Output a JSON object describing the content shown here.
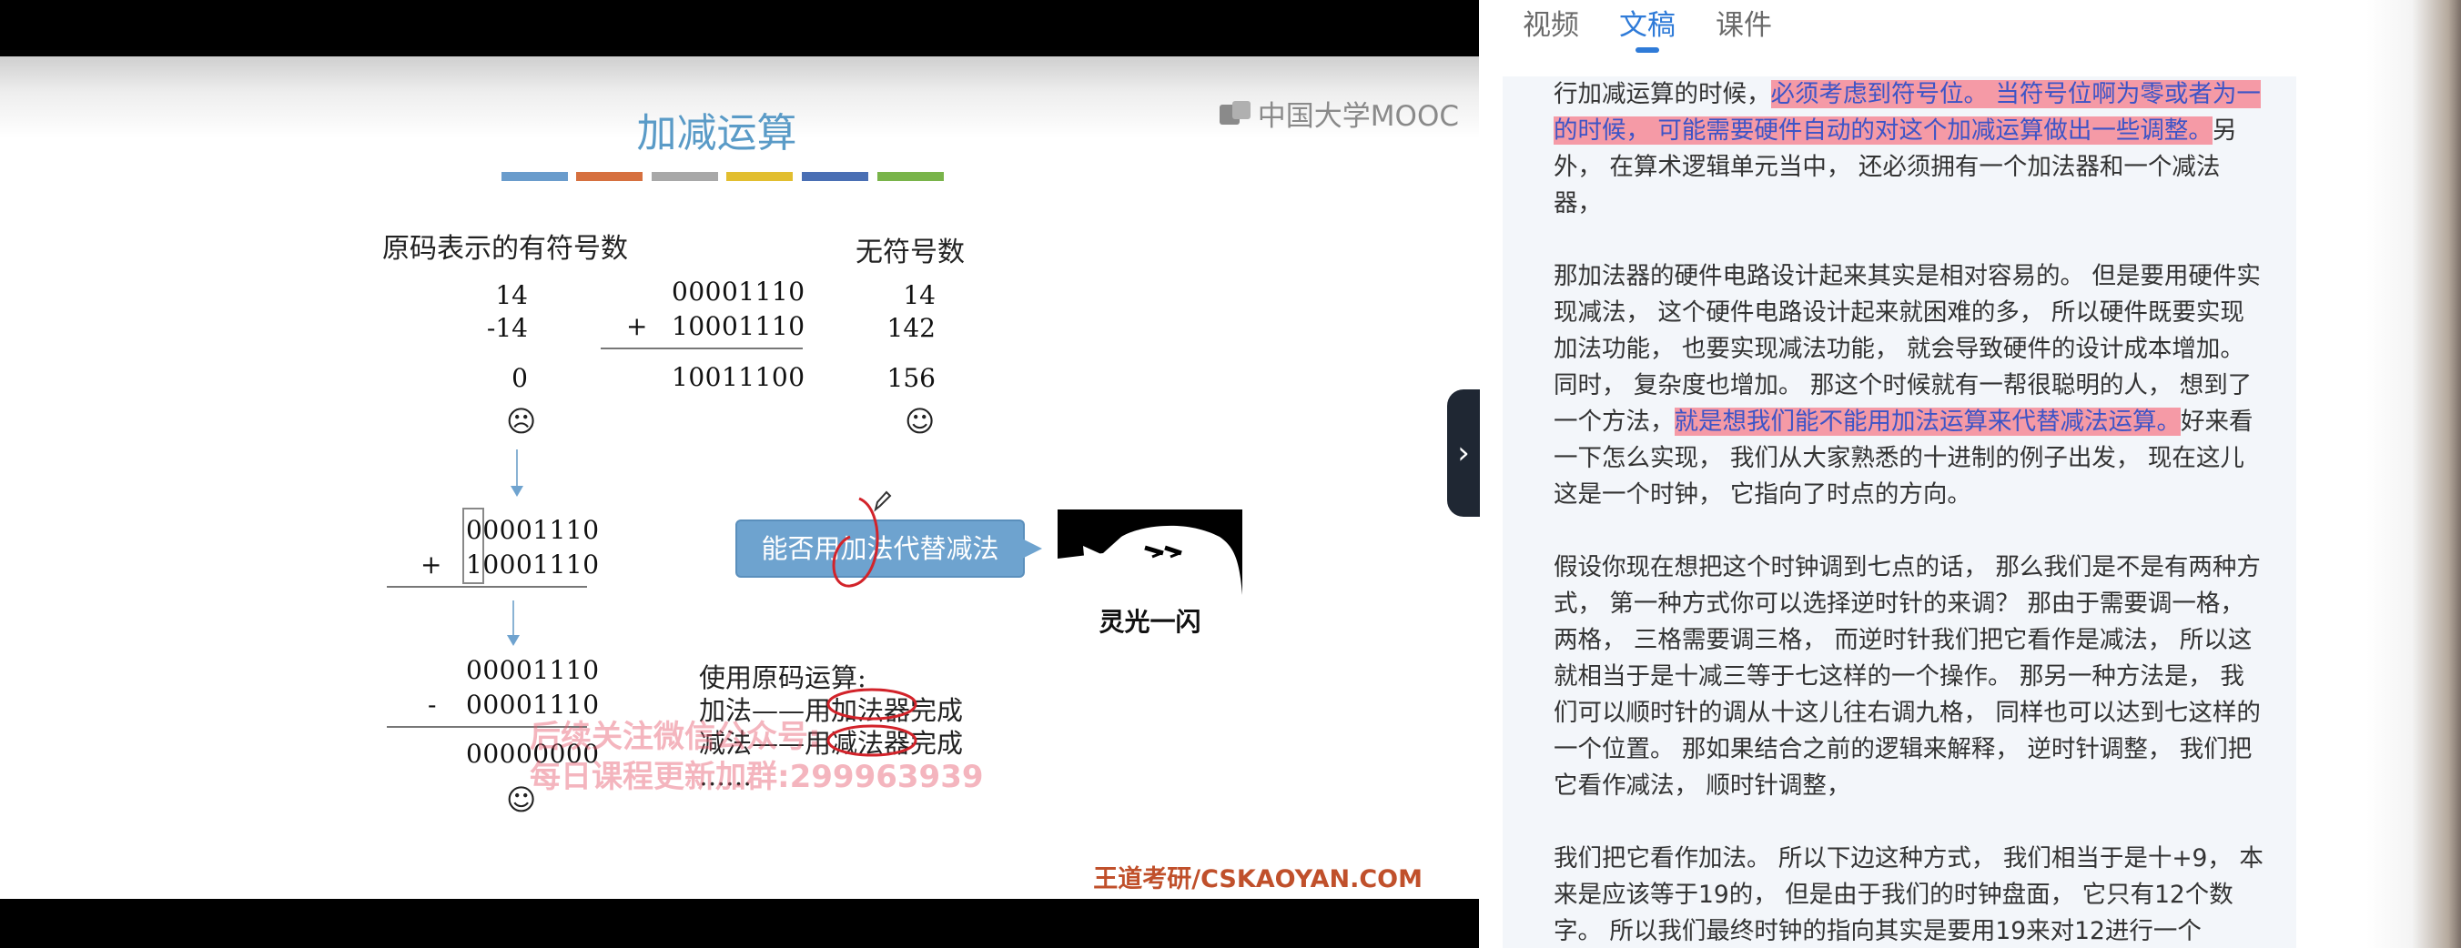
{
  "slide": {
    "title": "加减运算",
    "logo": "中国大学MOOC",
    "color_strip": [
      "#6a9ccc",
      "#d6703f",
      "#a8a8a8",
      "#e2be2f",
      "#4a6fb4",
      "#79b44a"
    ],
    "left_heading": "原码表示的有符号数",
    "right_heading": "无符号数",
    "signed_values": [
      "14",
      "-14",
      "0"
    ],
    "plus": "+",
    "minus": "-",
    "binary_a": "00001110",
    "binary_b": "10001110",
    "binary_sum": "10011100",
    "unsigned_values": [
      "14",
      "142",
      "156"
    ],
    "sad_face": "☹",
    "happy_face": "☺",
    "second_a": "00001110",
    "second_b": "10001110",
    "third_a": "00001110",
    "third_b": "00001110",
    "third_result": "00000000",
    "bubble_text": "能否用加法代替减法",
    "flash_label": "灵光一闪",
    "note_lines": [
      "使用原码运算:",
      "加法——用加法器完成",
      "减法——用减法器完成",
      "……"
    ],
    "watermark_lines": [
      "后续关注微信公众号:",
      "每日课程更新加群:299963939"
    ],
    "footer": "王道考研/CSKAOYAN.COM"
  },
  "tabs": [
    {
      "label": "视频",
      "active": false
    },
    {
      "label": "文稿",
      "active": true
    },
    {
      "label": "课件",
      "active": false
    }
  ],
  "toggle_icon": "chevron-right-icon",
  "toggle_glyph": "›",
  "transcript": {
    "p1_a": "行加减运算的时候，",
    "p1_hl": "必须考虑到符号位。 当符号位啊为零或者为一的时候， 可能需要硬件自动的对这个加减运算做出一些调整。",
    "p1_b": "另外， 在算术逻辑单元当中， 还必须拥有一个加法器和一个减法器，",
    "p2_a": "那加法器的硬件电路设计起来其实是相对容易的。 但是要用硬件实现减法， 这个硬件电路设计起来就困难的多， 所以硬件既要实现加法功能， 也要实现减法功能， 就会导致硬件的设计成本增加。 同时， 复杂度也增加。 那这个时候就有一帮很聪明的人， 想到了一个方法，",
    "p2_hl": "就是想我们能不能用加法运算来代替减法运算。",
    "p2_b": "好来看一下怎么实现， 我们从大家熟悉的十进制的例子出发， 现在这儿这是一个时钟， 它指向了时点的方向。",
    "p3": "假设你现在想把这个时钟调到七点的话， 那么我们是不是有两种方式， 第一种方式你可以选择逆时针的来调？ 那由于需要调一格， 两格， 三格需要调三格， 而逆时针我们把它看作是减法， 所以这就相当于是十减三等于七这样的一个操作。 那另一种方法是， 我们可以顺时针的调从十这儿往右调九格， 同样也可以达到七这样的一个位置。 那如果结合之前的逻辑来解释， 逆时针调整， 我们把它看作减法， 顺时针调整，",
    "p4": "我们把它看作加法。 所以下边这种方式， 我们相当于是十+9， 本来是应该等于19的， 但是由于我们的时钟盘面， 它只有12个数字。 所以我们最终时钟的指向其实是要用19来对12进行一个"
  }
}
